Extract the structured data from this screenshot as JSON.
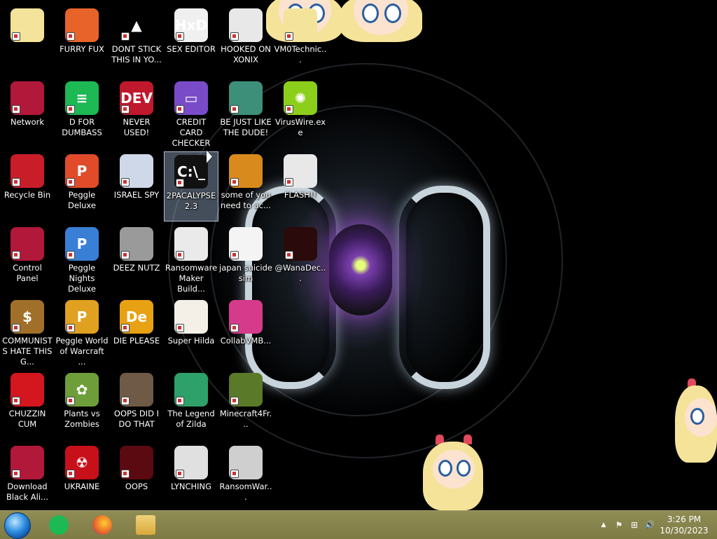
{
  "icons": [
    {
      "label": "",
      "glyph": "",
      "color": "#f4e39a"
    },
    {
      "label": "FURRY FUX",
      "glyph": "",
      "color": "#e8632a"
    },
    {
      "label": "DONT STICK THIS IN YO...",
      "glyph": "▲",
      "color": "#000000"
    },
    {
      "label": "SEX EDITOR",
      "glyph": "HxD",
      "color": "#f0f0f0"
    },
    {
      "label": "HOOKED ON XONIX",
      "glyph": "",
      "color": "#e8e8e8"
    },
    {
      "label": "VM0Technic...",
      "glyph": "",
      "color": "#f4e39a"
    },
    {
      "label": "Network",
      "glyph": "",
      "color": "#b1183a"
    },
    {
      "label": "D FOR DUMBASS",
      "glyph": "≡",
      "color": "#1db954"
    },
    {
      "label": "NEVER USED!",
      "glyph": "DEV",
      "color": "#c0182d"
    },
    {
      "label": "CREDIT CARD CHECKER",
      "glyph": "▭",
      "color": "#7a4bc9"
    },
    {
      "label": "BE JUST LIKE THE DUDE!",
      "glyph": "",
      "color": "#3d8f7a"
    },
    {
      "label": "VirusWire.exe",
      "glyph": "✺",
      "color": "#8ccf1b"
    },
    {
      "label": "Recycle Bin",
      "glyph": "",
      "color": "#c91e2a"
    },
    {
      "label": "Peggle Deluxe",
      "glyph": "P",
      "color": "#e14b2a"
    },
    {
      "label": "ISRAEL SPY",
      "glyph": "",
      "color": "#cfd8e8"
    },
    {
      "label": "2PACALYPSE 2.3",
      "glyph": "C:\\_",
      "color": "#111111"
    },
    {
      "label": "some of you need to ac...",
      "glyph": "",
      "color": "#d98a1d"
    },
    {
      "label": "FLASH!!",
      "glyph": "",
      "color": "#e8e8e8"
    },
    {
      "label": "Control Panel",
      "glyph": "",
      "color": "#b1183a"
    },
    {
      "label": "Peggle Nights Deluxe",
      "glyph": "P",
      "color": "#3a7fd6"
    },
    {
      "label": "DEEZ NUTZ",
      "glyph": "",
      "color": "#9a9a9a"
    },
    {
      "label": "Ransomware Maker Build...",
      "glyph": "",
      "color": "#eaeaea"
    },
    {
      "label": "japan suicide sim",
      "glyph": "",
      "color": "#f4f4f4"
    },
    {
      "label": "@WanaDec...",
      "glyph": "",
      "color": "#2a0a0a"
    },
    {
      "label": "COMMUNISTS HATE THIS G...",
      "glyph": "$",
      "color": "#a0702a"
    },
    {
      "label": "Peggle World of Warcraft ...",
      "glyph": "P",
      "color": "#e0a020"
    },
    {
      "label": "DIE PLEASE",
      "glyph": "De",
      "color": "#e8a112"
    },
    {
      "label": "Super Hilda",
      "glyph": "",
      "color": "#f4f0e8"
    },
    {
      "label": "CollabVMB...",
      "glyph": "",
      "color": "#d63a8a"
    },
    {
      "label": "CHUZZIN CUM",
      "glyph": "",
      "color": "#d4161e"
    },
    {
      "label": "Plants vs Zombies",
      "glyph": "✿",
      "color": "#6e9e3a"
    },
    {
      "label": "OOPS DID I DO THAT",
      "glyph": "",
      "color": "#6e5a46"
    },
    {
      "label": "The Legend of Zilda",
      "glyph": "",
      "color": "#2ea06a"
    },
    {
      "label": "Minecraft4Fr...",
      "glyph": "",
      "color": "#5a7a2a"
    },
    {
      "label": "Download Black Ali...",
      "glyph": "",
      "color": "#b1183a"
    },
    {
      "label": "UKRAINE",
      "glyph": "☢",
      "color": "#c8101a"
    },
    {
      "label": "OOPS",
      "glyph": "",
      "color": "#5a0a10"
    },
    {
      "label": "LYNCHING",
      "glyph": "",
      "color": "#e0e0e0"
    },
    {
      "label": "RansomWar...",
      "glyph": "",
      "color": "#cfcfcf"
    }
  ],
  "taskbar": {
    "apps": [
      {
        "name": "spotify-icon",
        "color": "#1db954"
      },
      {
        "name": "firefox-icon",
        "color": "#e8632a"
      },
      {
        "name": "file-explorer-icon",
        "color": "#e7c15a"
      }
    ],
    "tray_show_hidden": "▲",
    "tray_flag": "⚑",
    "tray_network": "⊞",
    "tray_volume": "🔊",
    "time": "3:26 PM",
    "date": "10/30/2023"
  }
}
